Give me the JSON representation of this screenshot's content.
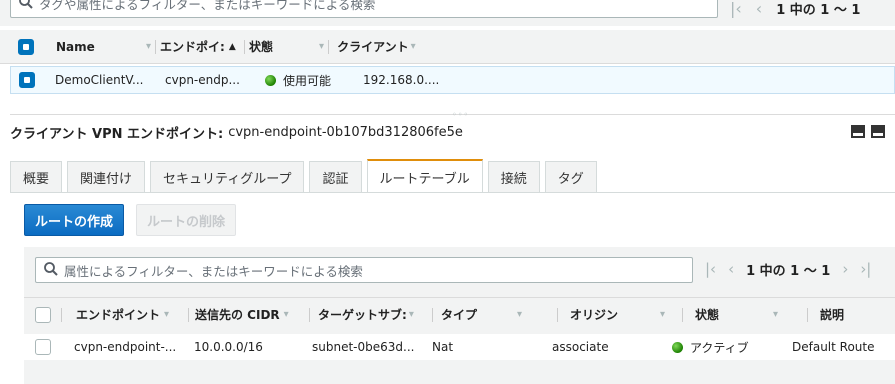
{
  "top": {
    "search_placeholder": "タグや属性によるフィルター、またはキーワードによる検索",
    "pager_text": "1 中の 1 ～ 1"
  },
  "endpoints": {
    "columns": [
      "Name",
      "エンドポイ:",
      "状態",
      "クライアント"
    ],
    "rows": [
      {
        "name": "DemoClientV...",
        "endpoint": "cvpn-endp...",
        "status": "使用可能",
        "client": "192.168.0...."
      }
    ]
  },
  "detail": {
    "title_label": "クライアント VPN エンドポイント:",
    "title_value": "cvpn-endpoint-0b107bd312806fe5e"
  },
  "tabs": [
    "概要",
    "関連付け",
    "セキュリティグループ",
    "認証",
    "ルートテーブル",
    "接続",
    "タグ"
  ],
  "active_tab": "ルートテーブル",
  "buttons": {
    "create_route": "ルートの作成",
    "delete_route": "ルートの削除"
  },
  "routes": {
    "search_placeholder": "属性によるフィルター、またはキーワードによる検索",
    "pager_text": "1 中の 1 ～ 1",
    "columns": [
      "エンドポイント",
      "送信先の CIDR",
      "ターゲットサブ:",
      "タイプ",
      "オリジン",
      "状態",
      "説明"
    ],
    "rows": [
      {
        "endpoint": "cvpn-endpoint-...",
        "cidr": "10.0.0.0/16",
        "subnet": "subnet-0be63d...",
        "type": "Nat",
        "origin": "associate",
        "status": "アクティブ",
        "description": "Default Route"
      }
    ]
  },
  "colors": {
    "accent": "#0073bb",
    "primary_button": "#0b6cc2",
    "active_tab": "#e08e0b",
    "status_green": "#1d8102"
  }
}
